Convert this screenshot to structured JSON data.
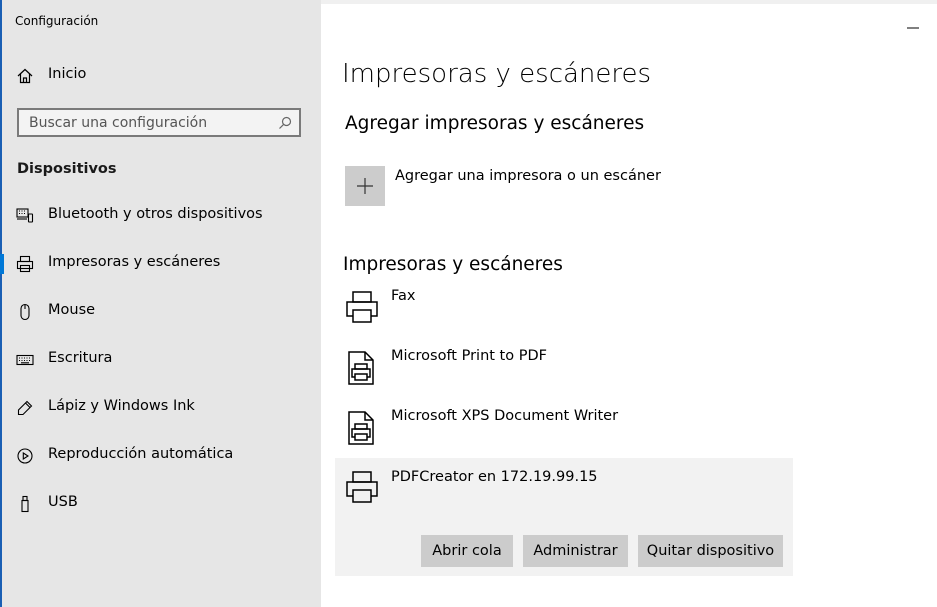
{
  "window": {
    "title": "Configuración"
  },
  "sidebar": {
    "home_label": "Inicio",
    "search_placeholder": "Buscar una configuración",
    "section": "Dispositivos",
    "items": [
      {
        "label": "Bluetooth y otros dispositivos",
        "icon": "keyboard-device-icon"
      },
      {
        "label": "Impresoras y escáneres",
        "icon": "printer-icon",
        "selected": true
      },
      {
        "label": "Mouse",
        "icon": "mouse-icon"
      },
      {
        "label": "Escritura",
        "icon": "keyboard-icon"
      },
      {
        "label": "Lápiz y Windows Ink",
        "icon": "pen-icon"
      },
      {
        "label": "Reproducción automática",
        "icon": "autoplay-icon"
      },
      {
        "label": "USB",
        "icon": "usb-icon"
      }
    ]
  },
  "main": {
    "title": "Impresoras y escáneres",
    "add_section_title": "Agregar impresoras y escáneres",
    "add_button_label": "Agregar una impresora o un escáner",
    "list_title": "Impresoras y escáneres",
    "printers": [
      {
        "name": "Fax"
      },
      {
        "name": "Microsoft Print to PDF"
      },
      {
        "name": "Microsoft XPS Document Writer"
      },
      {
        "name": "PDFCreator en 172.19.99.15",
        "selected": true
      }
    ],
    "actions": {
      "open_queue": "Abrir cola",
      "manage": "Administrar",
      "remove": "Quitar dispositivo"
    }
  },
  "colors": {
    "accent": "#0078d7",
    "sidebar_bg": "#e6e6e6",
    "button_bg": "#cccccc"
  }
}
